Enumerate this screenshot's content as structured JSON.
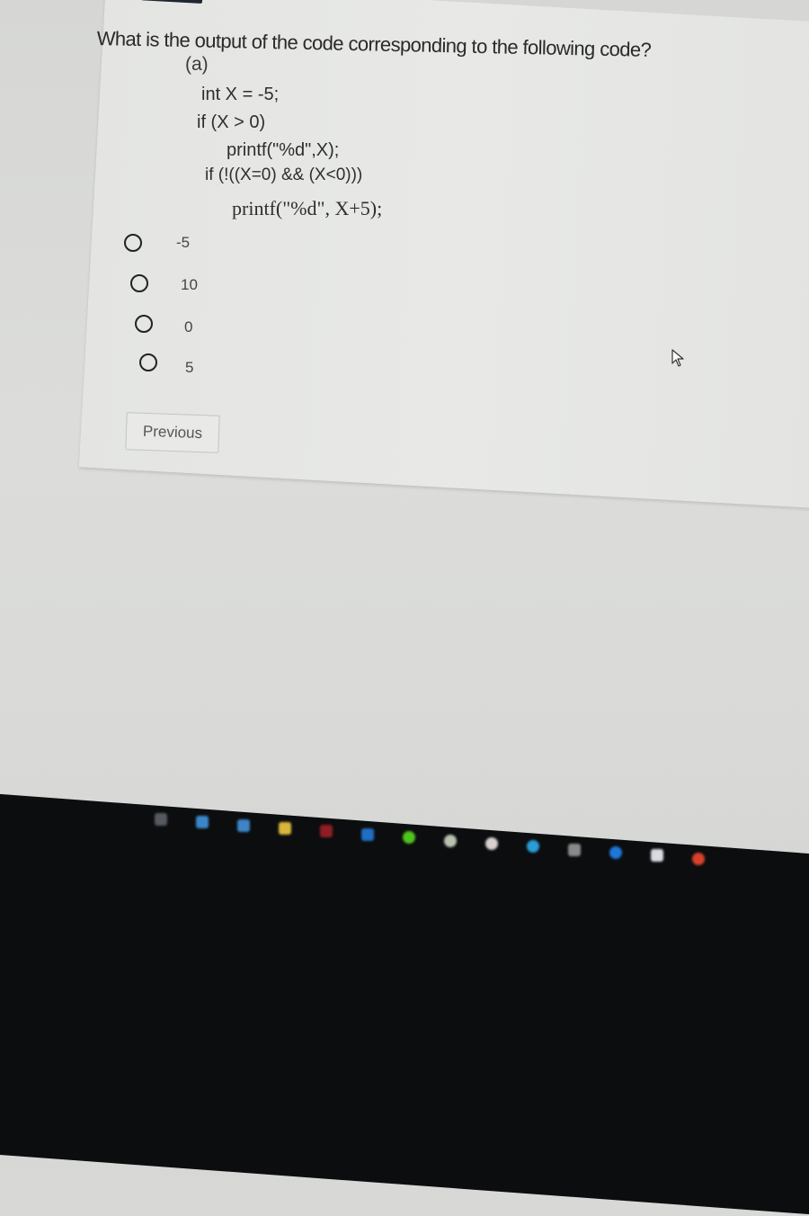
{
  "quiz": {
    "question": "What is the output of the code corresponding to the following code?",
    "part_label": "(a)",
    "code_lines": [
      "int X = -5;",
      "if (X > 0)",
      "printf(\"%d\",X);",
      "if (!((X=0) && (X<0)))",
      "printf(\"%d\", X+5);"
    ],
    "options": [
      {
        "label": "-5",
        "selected": false
      },
      {
        "label": "10",
        "selected": false
      },
      {
        "label": "0",
        "selected": false
      },
      {
        "label": "5",
        "selected": false
      }
    ],
    "previous_label": "Previous"
  },
  "taskbar": {
    "icons": [
      {
        "name": "task-view-icon",
        "color": "#555a60"
      },
      {
        "name": "mail-icon",
        "color": "#3a86c8"
      },
      {
        "name": "edge-icon",
        "color": "#3e84c6"
      },
      {
        "name": "file-explorer-icon",
        "color": "#d9b53c"
      },
      {
        "name": "app-red-icon",
        "color": "#8e1d24"
      },
      {
        "name": "outlook-icon",
        "color": "#1f6fc2"
      },
      {
        "name": "razer-icon",
        "color": "#4fc41c"
      },
      {
        "name": "xbox-icon",
        "color": "#b8c2b0"
      },
      {
        "name": "app-circle-icon",
        "color": "#d8cfd0"
      },
      {
        "name": "telegram-icon",
        "color": "#2a9cd8"
      },
      {
        "name": "app-grid-icon",
        "color": "#8a8a8a"
      },
      {
        "name": "app-blue-icon",
        "color": "#1e78d8"
      },
      {
        "name": "notepad-icon",
        "color": "#d8dbe0"
      },
      {
        "name": "chrome-icon",
        "color": "#d8402a"
      }
    ]
  }
}
